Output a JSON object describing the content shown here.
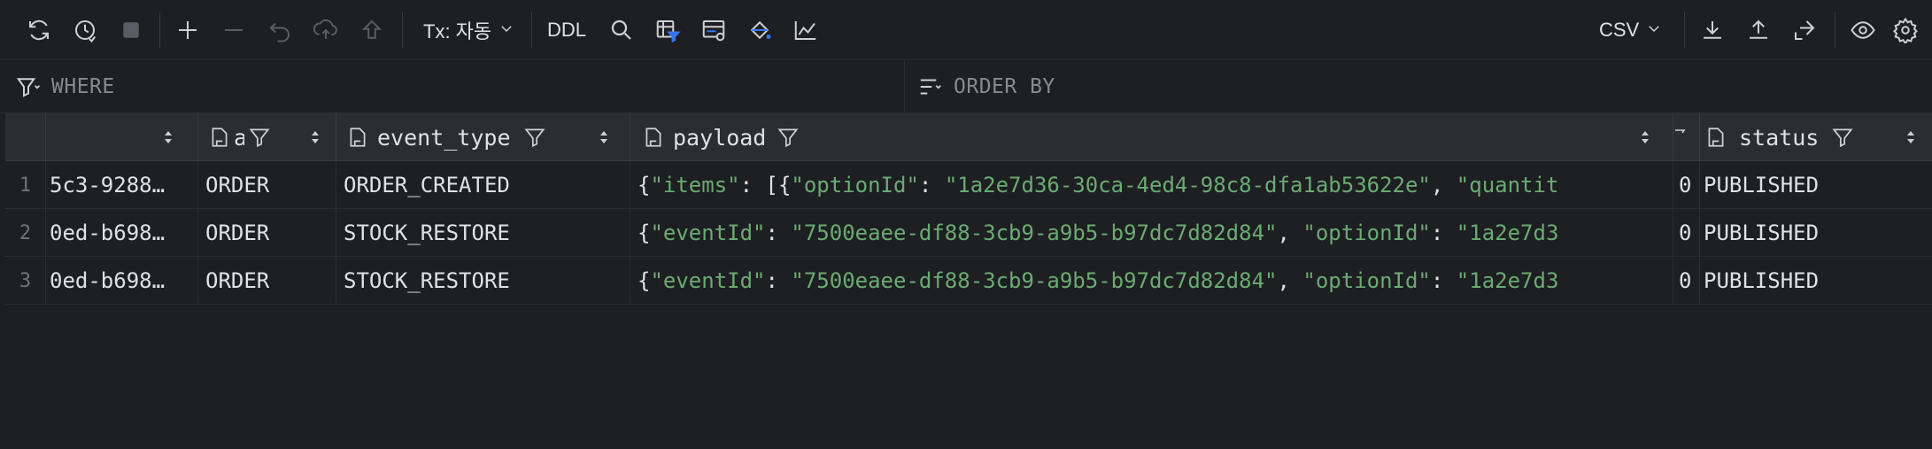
{
  "toolbar": {
    "tx_label": "Tx: 자동",
    "ddl_label": "DDL",
    "export_format": "CSV",
    "icons": [
      "refresh-icon",
      "history-icon",
      "stop-icon",
      "add-row-icon",
      "delete-row-icon",
      "revert-icon",
      "submit-icon",
      "push-icon",
      "search-icon",
      "filter-table-icon",
      "view-query-icon",
      "paint-icon",
      "chart-icon",
      "download-icon",
      "upload-icon",
      "compare-icon",
      "view-icon",
      "settings-icon"
    ]
  },
  "filters": {
    "where_placeholder": "WHERE",
    "order_placeholder": "ORDER BY"
  },
  "columns": [
    {
      "name": ""
    },
    {
      "name": "a"
    },
    {
      "name": "event_type"
    },
    {
      "name": "payload"
    },
    {
      "name": ""
    },
    {
      "name": "status"
    }
  ],
  "rows": [
    {
      "num": "1",
      "id": "5c3-9288…",
      "agg": "ORDER",
      "event_type": "ORDER_CREATED",
      "payload": {
        "k1": "\"items\"",
        "p1": ": [{",
        "k2": "\"optionId\"",
        "p2": ": ",
        "v2": "\"1a2e7d36-30ca-4ed4-98c8-dfa1ab53622e\"",
        "p3": ", ",
        "k3": "\"quantit"
      },
      "retry": "0",
      "status": "PUBLISHED"
    },
    {
      "num": "2",
      "id": "0ed-b698…",
      "agg": "ORDER",
      "event_type": "STOCK_RESTORE",
      "payload": {
        "k1": "\"eventId\"",
        "p1": ": ",
        "v1": "\"7500eaee-df88-3cb9-a9b5-b97dc7d82d84\"",
        "p2": ", ",
        "k2": "\"optionId\"",
        "p3": ": ",
        "v2": "\"1a2e7d3"
      },
      "retry": "0",
      "status": "PUBLISHED"
    },
    {
      "num": "3",
      "id": "0ed-b698…",
      "agg": "ORDER",
      "event_type": "STOCK_RESTORE",
      "payload": {
        "k1": "\"eventId\"",
        "p1": ": ",
        "v1": "\"7500eaee-df88-3cb9-a9b5-b97dc7d82d84\"",
        "p2": ", ",
        "k2": "\"optionId\"",
        "p3": ": ",
        "v2": "\"1a2e7d3"
      },
      "retry": "0",
      "status": "PUBLISHED"
    }
  ],
  "colors": {
    "background": "#1e1f22",
    "header": "#2b2d30",
    "json_string": "#6aab73",
    "accent_blue": "#3574f0"
  }
}
